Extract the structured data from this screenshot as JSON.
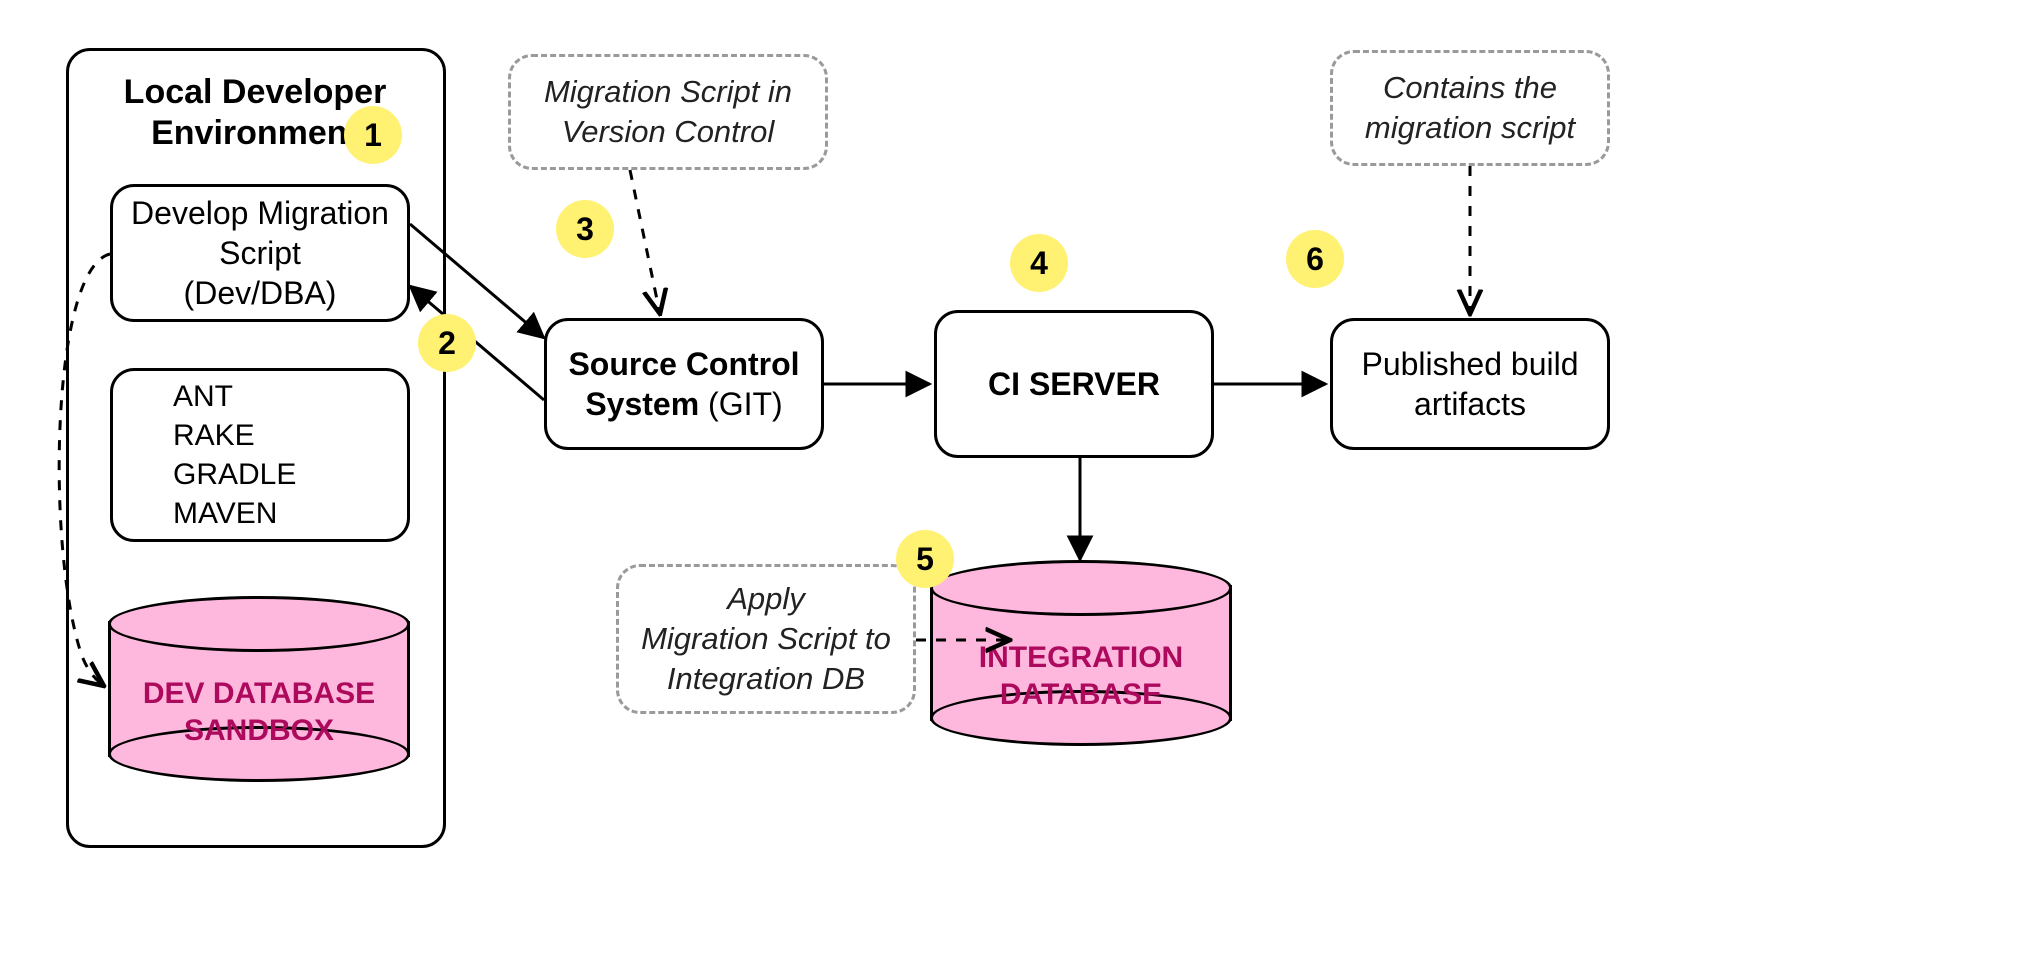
{
  "env": {
    "title_l1": "Local Developer",
    "title_l2": "Environment"
  },
  "nodes": {
    "develop_l1": "Develop Migration",
    "develop_l2": "Script",
    "develop_l3": "(Dev/DBA)",
    "scs_l1": "Source Control",
    "scs_l2_bold": "System",
    "scs_l2_rest": "(GIT)",
    "ci": "CI SERVER",
    "artifacts_l1": "Published build",
    "artifacts_l2": "artifacts",
    "dev_db_l1": "DEV DATABASE",
    "dev_db_l2": "SANDBOX",
    "int_db_l1": "INTEGRATION",
    "int_db_l2": "DATABASE"
  },
  "tools": {
    "items": [
      "ANT",
      "RAKE",
      "GRADLE",
      "MAVEN"
    ]
  },
  "annotations": {
    "a3_l1": "Migration Script in",
    "a3_l2": "Version Control",
    "a5_l1": "Apply",
    "a5_l2": "Migration Script to",
    "a5_l3": "Integration DB",
    "a6_l1": "Contains the",
    "a6_l2": "migration script"
  },
  "badges": {
    "b1": "1",
    "b2": "2",
    "b3": "3",
    "b4": "4",
    "b5": "5",
    "b6": "6"
  }
}
